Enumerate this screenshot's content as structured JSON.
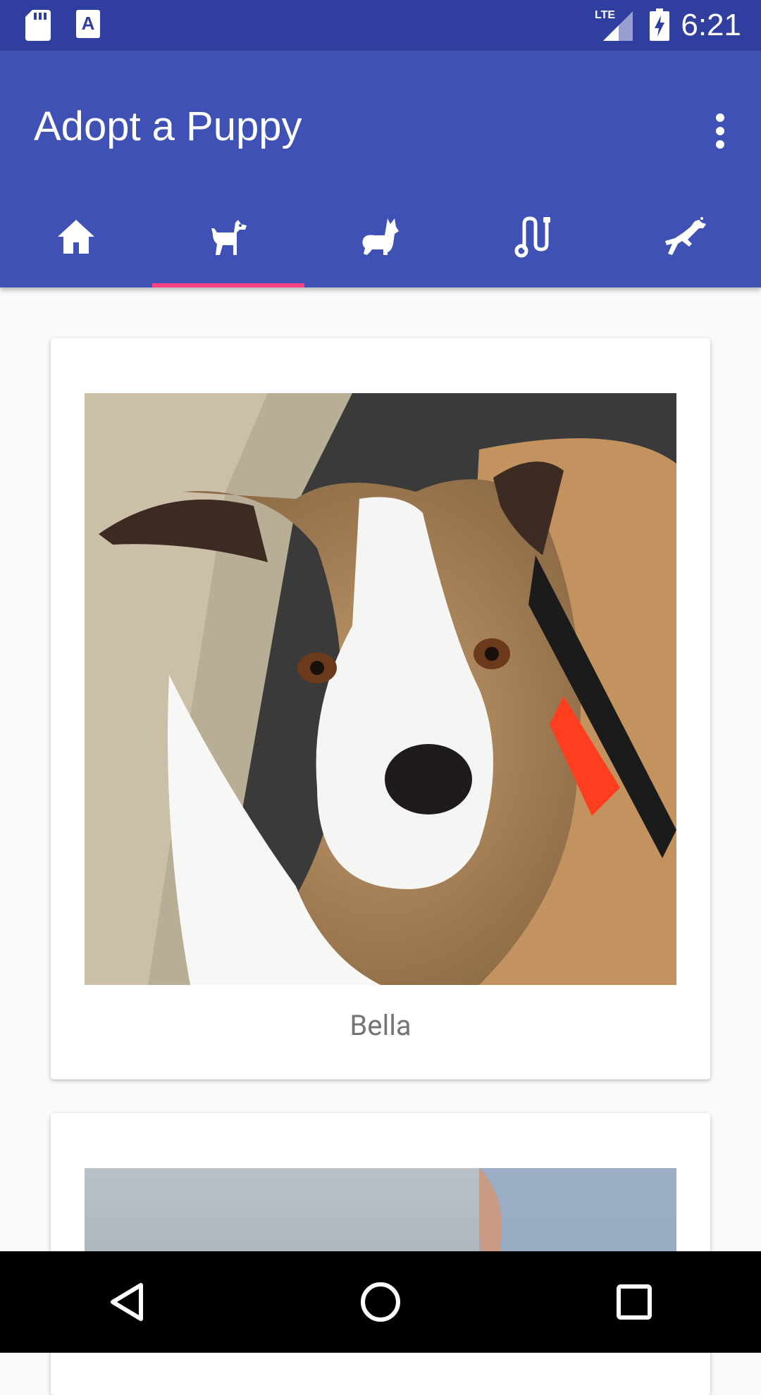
{
  "status_bar": {
    "time": "6:21",
    "network_label": "LTE",
    "icons": [
      "sd-card-icon",
      "text-a-icon",
      "lte-signal-icon",
      "battery-charging-icon"
    ]
  },
  "app_bar": {
    "title": "Adopt a Puppy",
    "overflow_icon": "more-vert-icon",
    "color": "#3f51b5",
    "status_color": "#303f9f",
    "indicator_color": "#ff4081"
  },
  "tabs": [
    {
      "icon": "home-icon",
      "active": false
    },
    {
      "icon": "dog-standing-icon",
      "active": true
    },
    {
      "icon": "corgi-icon",
      "active": false
    },
    {
      "icon": "leash-icon",
      "active": false
    },
    {
      "icon": "running-dog-icon",
      "active": false
    }
  ],
  "cards": [
    {
      "name": "Bella",
      "image": "dog-photo-bella"
    },
    {
      "name": "",
      "image": "dog-photo-partial"
    }
  ],
  "nav_bar": {
    "buttons": [
      "back-icon",
      "home-circle-icon",
      "recents-icon"
    ]
  }
}
